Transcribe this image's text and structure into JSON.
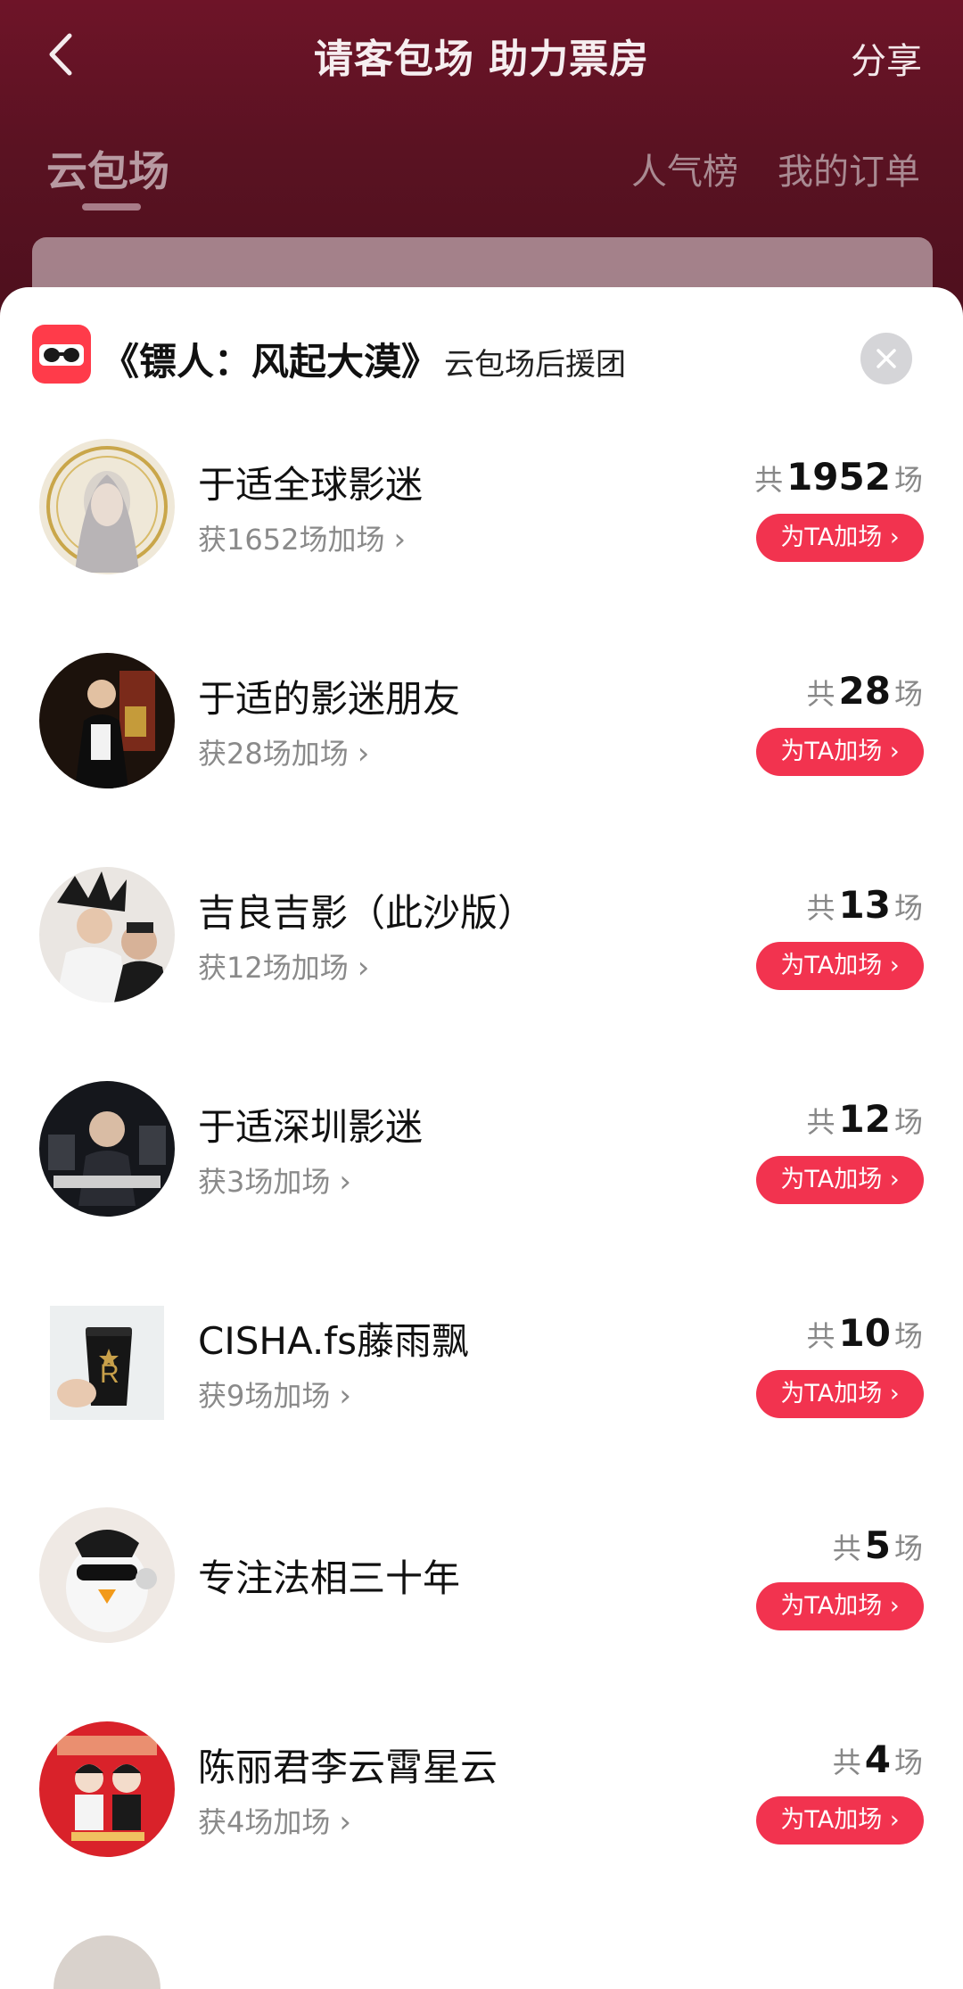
{
  "header": {
    "title": "请客包场 助力票房",
    "share_label": "分享"
  },
  "tabs": {
    "yun": "云包场",
    "rank": "人气榜",
    "orders": "我的订单"
  },
  "sheet": {
    "movie_title": "《镖人：风起大漠》",
    "title_suffix": "云包场后援团"
  },
  "rows": [
    {
      "name": "于适全球影迷",
      "sub": "获1652场加场",
      "total_prefix": "共",
      "total": "1952",
      "total_suffix": "场",
      "button": "为TA加场 ›"
    },
    {
      "name": "于适的影迷朋友",
      "sub": "获28场加场",
      "total_prefix": "共",
      "total": "28",
      "total_suffix": "场",
      "button": "为TA加场 ›"
    },
    {
      "name": "吉良吉影（此沙版）",
      "sub": "获12场加场",
      "total_prefix": "共",
      "total": "13",
      "total_suffix": "场",
      "button": "为TA加场 ›"
    },
    {
      "name": "于适深圳影迷",
      "sub": "获3场加场",
      "total_prefix": "共",
      "total": "12",
      "total_suffix": "场",
      "button": "为TA加场 ›"
    },
    {
      "name": "CISHA.fs藤雨飘",
      "sub": "获9场加场",
      "total_prefix": "共",
      "total": "10",
      "total_suffix": "场",
      "button": "为TA加场 ›"
    },
    {
      "name": "专注法相三十年",
      "sub": "",
      "total_prefix": "共",
      "total": "5",
      "total_suffix": "场",
      "button": "为TA加场 ›"
    },
    {
      "name": "陈丽君李云霄星云",
      "sub": "获4场加场",
      "total_prefix": "共",
      "total": "4",
      "total_suffix": "场",
      "button": "为TA加场 ›"
    }
  ],
  "colors": {
    "header_bg": "#5a1222",
    "accent": "#f2334f"
  }
}
